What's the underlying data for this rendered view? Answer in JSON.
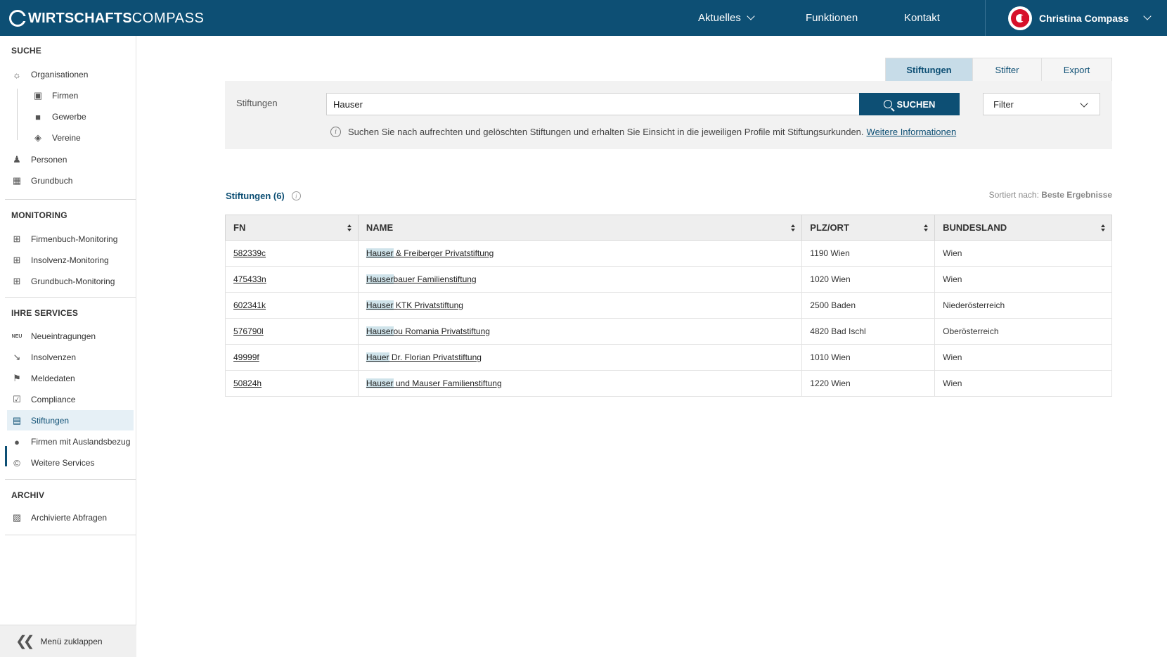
{
  "header": {
    "logo_bold": "WIRTSCHAFTS",
    "logo_light": "COMPASS",
    "nav": [
      {
        "label": "Aktuelles",
        "has_dropdown": true
      },
      {
        "label": "Funktionen"
      },
      {
        "label": "Kontakt"
      }
    ],
    "user_name": "Christina Compass",
    "colors": {
      "bar": "#0d4f74",
      "accent": "#d6102a"
    }
  },
  "sidebar": {
    "sections": {
      "suche": "SUCHE",
      "monitoring": "MONITORING",
      "services": "IHRE SERVICES",
      "archiv": "ARCHIV"
    },
    "suche_items": [
      {
        "label": "Organisationen",
        "icon": "compass-icon"
      },
      {
        "label": "Firmen",
        "icon": "factory-icon"
      },
      {
        "label": "Gewerbe",
        "icon": "briefcase-icon"
      },
      {
        "label": "Vereine",
        "icon": "shield-icon"
      },
      {
        "label": "Personen",
        "icon": "person-icon"
      },
      {
        "label": "Grundbuch",
        "icon": "book-icon"
      }
    ],
    "monitoring_items": [
      {
        "label": "Firmenbuch-Monitoring",
        "icon": "monitor-add-icon"
      },
      {
        "label": "Insolvenz-Monitoring",
        "icon": "monitor-add-icon"
      },
      {
        "label": "Grundbuch-Monitoring",
        "icon": "monitor-add-icon"
      }
    ],
    "services_items": [
      {
        "label": "Neueintragungen",
        "icon": "neu-badge",
        "badge": "NEU"
      },
      {
        "label": "Insolvenzen",
        "icon": "chart-down-icon"
      },
      {
        "label": "Meldedaten",
        "icon": "flag-icon"
      },
      {
        "label": "Compliance",
        "icon": "checkbox-icon"
      },
      {
        "label": "Stiftungen",
        "icon": "building-columns-icon",
        "active": true
      },
      {
        "label": "Firmen mit Auslandsbezug",
        "icon": "globe-icon"
      },
      {
        "label": "Weitere Services",
        "icon": "compass-c-icon"
      }
    ],
    "archiv_items": [
      {
        "label": "Archivierte Abfragen",
        "icon": "archive-icon"
      }
    ],
    "collapse_label": "Menü zuklappen"
  },
  "tabs": [
    {
      "label": "Stiftungen",
      "active": true
    },
    {
      "label": "Stifter"
    },
    {
      "label": "Export"
    }
  ],
  "search": {
    "label": "Stiftungen",
    "value": "Hauser",
    "button_label": "SUCHEN",
    "filter_label": "Filter",
    "info_text": "Suchen Sie nach aufrechten und gelöschten Stiftungen und erhalten Sie Einsicht in die jeweiligen Profile mit Stiftungsurkunden.",
    "info_link": "Weitere Informationen"
  },
  "results": {
    "title": "Stiftungen (6)",
    "sort_prefix": "Sortiert nach:",
    "sort_value": "Beste Ergebnisse",
    "columns": [
      "FN",
      "NAME",
      "PLZ/ORT",
      "BUNDESLAND"
    ],
    "rows": [
      {
        "fn": "582339c",
        "name_hl": "Hauser",
        "name_rest": " & Freiberger Privatstiftung",
        "ort": "1190 Wien",
        "land": "Wien"
      },
      {
        "fn": "475433n",
        "name_hl": "Hauser",
        "name_rest": "bauer Familienstiftung",
        "ort": "1020 Wien",
        "land": "Wien"
      },
      {
        "fn": "602341k",
        "name_hl": "Hauser",
        "name_rest": " KTK Privatstiftung",
        "ort": "2500 Baden",
        "land": "Niederösterreich"
      },
      {
        "fn": "576790l",
        "name_hl": "Hauser",
        "name_rest": "ou Romania Privatstiftung",
        "ort": "4820 Bad Ischl",
        "land": "Oberösterreich"
      },
      {
        "fn": "49999f",
        "name_hl": "Hauer",
        "name_rest": " Dr. Florian Privatstiftung",
        "ort": "1010 Wien",
        "land": "Wien"
      },
      {
        "fn": "50824h",
        "name_hl": "Hauser",
        "name_rest": " und Mauser Familienstiftung",
        "ort": "1220 Wien",
        "land": "Wien"
      }
    ]
  }
}
